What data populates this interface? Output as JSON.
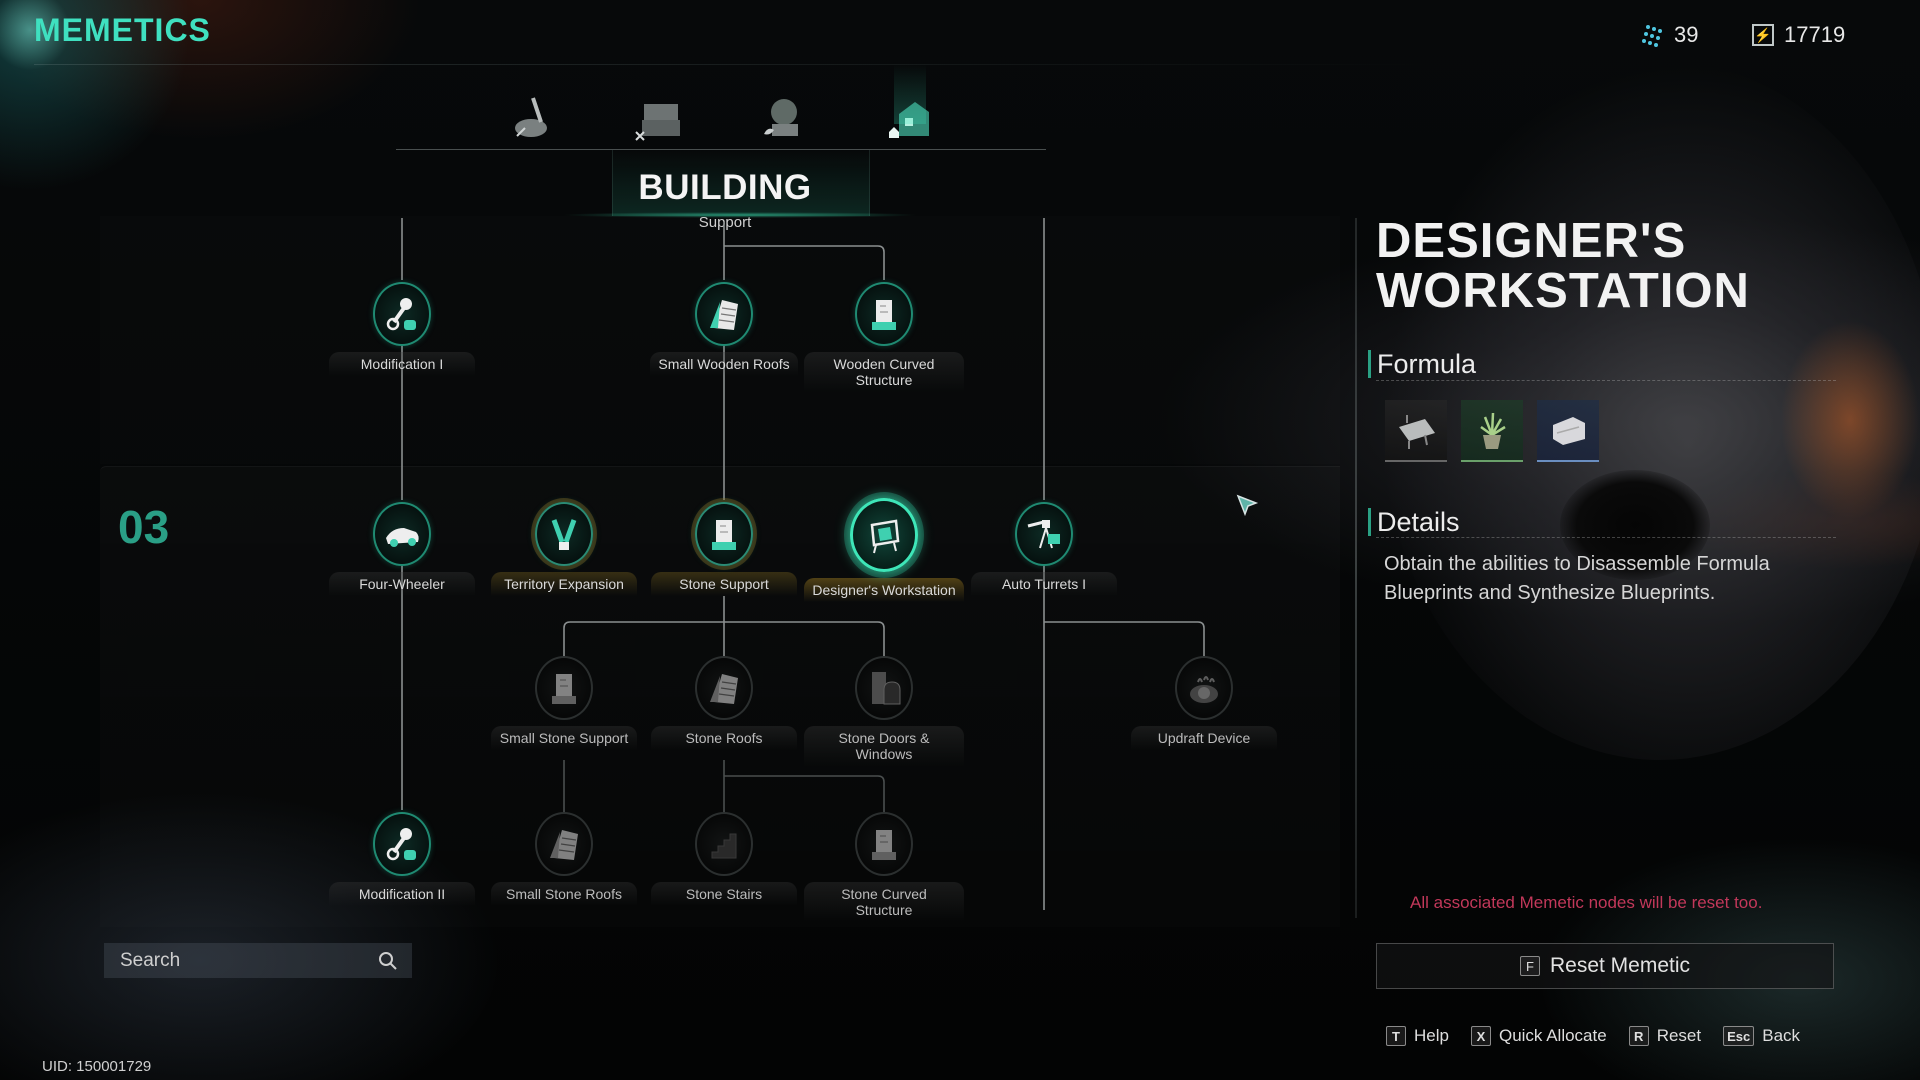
{
  "app": {
    "title": "MEMETICS"
  },
  "currencies": [
    {
      "icon": "dna-icon",
      "value": "39"
    },
    {
      "icon": "energy-icon",
      "value": "17719"
    }
  ],
  "category_tabs": [
    {
      "name": "tab-combat",
      "icon": "axe-creature-icon",
      "active": false
    },
    {
      "name": "tab-crafting",
      "icon": "workbench-icon",
      "active": false
    },
    {
      "name": "tab-farming",
      "icon": "planter-icon",
      "active": false
    },
    {
      "name": "tab-building",
      "icon": "house-icon",
      "active": true
    }
  ],
  "category": {
    "title": "BUILDING",
    "subtitle": "Support"
  },
  "tier": {
    "label": "03"
  },
  "nodes": [
    {
      "id": "mod1",
      "label": "Modification I",
      "state": "unlocked",
      "icon": "piston-icon"
    },
    {
      "id": "swr",
      "label": "Small Wooden Roofs",
      "state": "unlocked",
      "icon": "roof-icon"
    },
    {
      "id": "wcs",
      "label": "Wooden Curved Structure",
      "state": "unlocked",
      "icon": "pillar-icon"
    },
    {
      "id": "fw",
      "label": "Four-Wheeler",
      "state": "unlocked",
      "icon": "car-icon"
    },
    {
      "id": "te",
      "label": "Territory Expansion",
      "state": "unlockable",
      "icon": "tower-icon"
    },
    {
      "id": "ss",
      "label": "Stone Support",
      "state": "unlockable",
      "icon": "pillar-icon"
    },
    {
      "id": "dw",
      "label": "Designer's Workstation",
      "state": "selected",
      "icon": "drafting-table-icon"
    },
    {
      "id": "at",
      "label": "Auto Turrets I",
      "state": "unlocked",
      "icon": "turret-icon"
    },
    {
      "id": "sss",
      "label": "Small Stone Support",
      "state": "locked",
      "icon": "pillar-icon"
    },
    {
      "id": "sr",
      "label": "Stone Roofs",
      "state": "locked",
      "icon": "roof-icon"
    },
    {
      "id": "sdw",
      "label": "Stone Doors & Windows",
      "state": "locked",
      "icon": "door-window-icon"
    },
    {
      "id": "ud",
      "label": "Updraft Device",
      "state": "locked",
      "icon": "fan-icon"
    },
    {
      "id": "mod2",
      "label": "Modification II",
      "state": "unlocked",
      "icon": "piston-icon"
    },
    {
      "id": "ssr",
      "label": "Small Stone Roofs",
      "state": "locked",
      "icon": "roof-icon"
    },
    {
      "id": "sst",
      "label": "Stone Stairs",
      "state": "locked",
      "icon": "stairs-icon"
    },
    {
      "id": "scs",
      "label": "Stone Curved Structure",
      "state": "locked",
      "icon": "pillar-icon"
    }
  ],
  "search": {
    "placeholder": "Search",
    "value": ""
  },
  "uid": "UID: 150001729",
  "detail": {
    "title": "DESIGNER'S WORKSTATION",
    "formula_heading": "Formula",
    "formula_items": [
      {
        "icon": "drafting-board-icon",
        "rarity": "gray"
      },
      {
        "icon": "potted-plant-icon",
        "rarity": "green"
      },
      {
        "icon": "armchair-icon",
        "rarity": "blue"
      }
    ],
    "details_heading": "Details",
    "details_text": "Obtain the abilities to Disassemble Formula Blueprints and Synthesize Blueprints.",
    "warning": "All associated Memetic nodes will be reset too.",
    "reset_button": {
      "key": "F",
      "label": "Reset Memetic"
    }
  },
  "hints": [
    {
      "key": "T",
      "label": "Help"
    },
    {
      "key": "X",
      "label": "Quick Allocate"
    },
    {
      "key": "R",
      "label": "Reset"
    },
    {
      "key": "Esc",
      "label": "Back"
    }
  ],
  "colors": {
    "accent": "#3fe0c0",
    "tier": "#2a9f86",
    "warning": "#c2385a",
    "selected_glow": "#3ee6b8"
  }
}
